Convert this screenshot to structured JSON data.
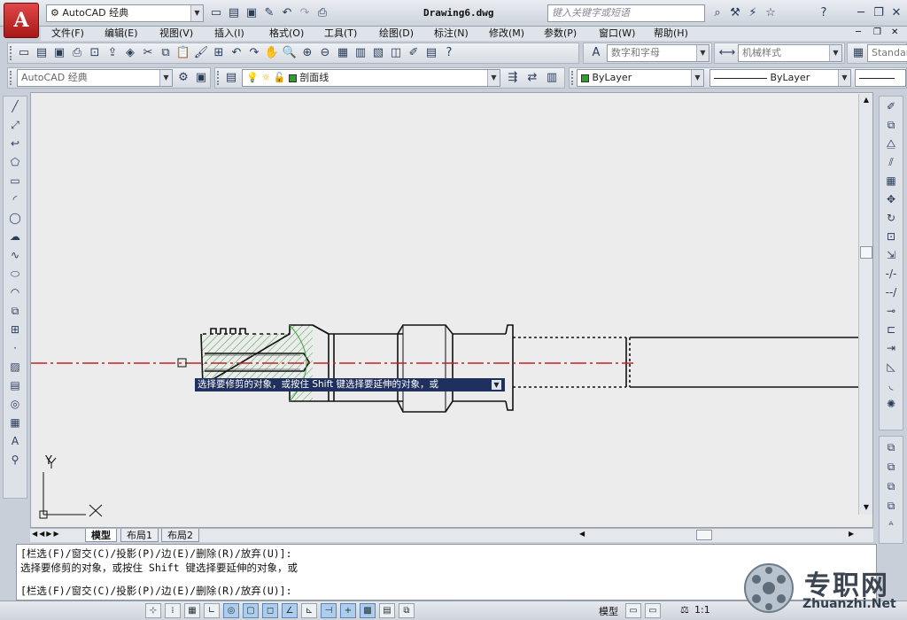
{
  "app": {
    "logo_letter": "A",
    "workspace": "AutoCAD 经典",
    "file_title": "Drawing6.dwg",
    "search_placeholder": "键入关键字或短语"
  },
  "menu": [
    "文件(F)",
    "编辑(E)",
    "视图(V)",
    "插入(I)",
    "格式(O)",
    "工具(T)",
    "绘图(D)",
    "标注(N)",
    "修改(M)",
    "参数(P)",
    "窗口(W)",
    "帮助(H)"
  ],
  "toolbar2": {
    "text_style": "数字和字母",
    "dim_style": "机械样式",
    "table_style": "Standard"
  },
  "toolbar3": {
    "workspace": "AutoCAD 经典",
    "layer": "剖面线",
    "color": "ByLayer",
    "linetype": "ByLayer"
  },
  "tooltip": "选择要修剪的对象，或按住 Shift 键选择要延伸的对象，或",
  "ucs": {
    "y_label": "Y",
    "x_label": "X"
  },
  "tabs": [
    "模型",
    "布局1",
    "布局2"
  ],
  "command": {
    "line1": "[栏选(F)/窗交(C)/投影(P)/边(E)/删除(R)/放弃(U)]:",
    "line2": "选择要修剪的对象，或按住 Shift 键选择要延伸的对象，或",
    "line3": "[栏选(F)/窗交(C)/投影(P)/边(E)/删除(R)/放弃(U)]:"
  },
  "status": {
    "model_label": "模型",
    "scale": "1:1"
  },
  "watermark": {
    "brand": "专职网",
    "domain": "Zhuanzhi.Net"
  },
  "colors": {
    "centerline": "#c0202a",
    "hatch": "#3fa43f",
    "tooltip_bg": "#1f2f5e",
    "canvas_bg": "#ececec"
  }
}
